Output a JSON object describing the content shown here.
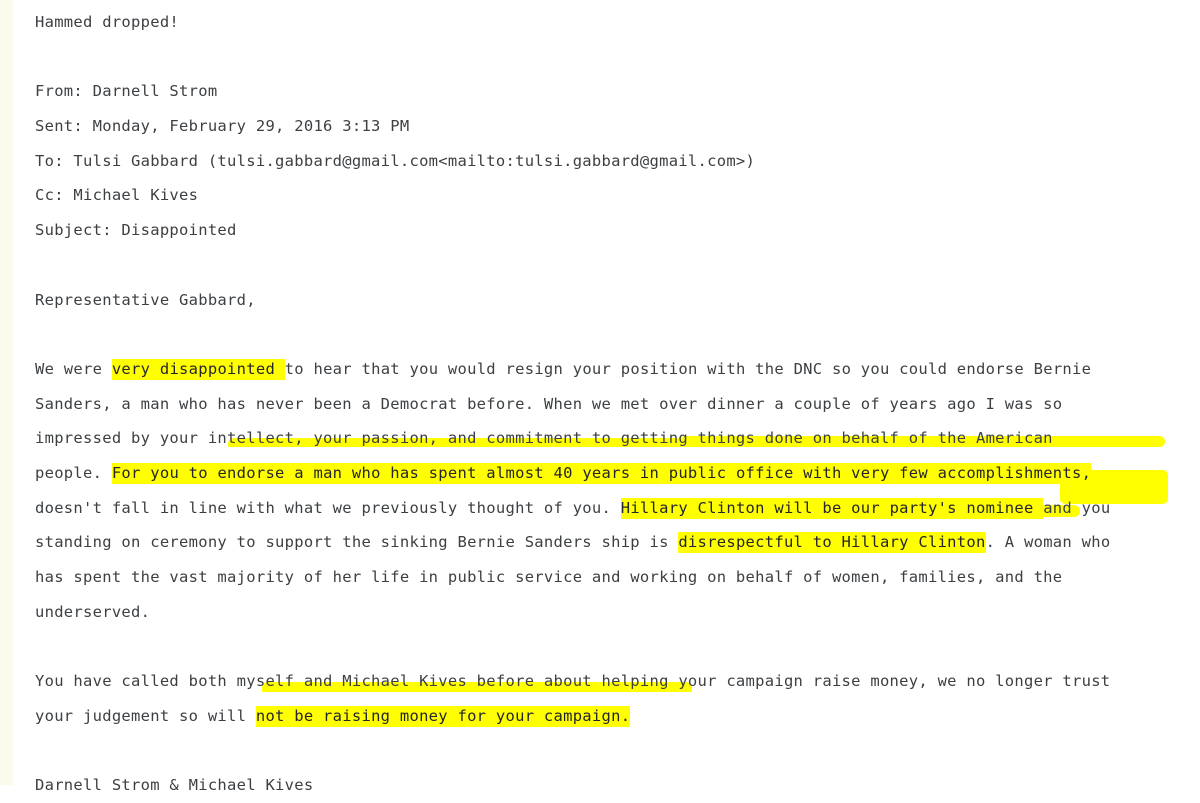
{
  "colors": {
    "page_background": "#ffffff",
    "left_strip": "#fbfaec",
    "body_text": "#3d4043",
    "highlight": "#ffff00",
    "highlighted_text": "#24262a"
  },
  "email": {
    "intro_note": "Hammed dropped!",
    "headers": [
      {
        "label": "From:",
        "value": "Darnell Strom",
        "full": "From: Darnell Strom"
      },
      {
        "label": "Sent:",
        "value": "Monday, February 29, 2016 3:13 PM",
        "full": "Sent: Monday, February 29, 2016 3:13 PM"
      },
      {
        "label": "To:",
        "value": "Tulsi Gabbard (tulsi.gabbard@gmail.com<mailto:tulsi.gabbard@gmail.com>)",
        "full": "To: Tulsi Gabbard (tulsi.gabbard@gmail.com<mailto:tulsi.gabbard@gmail.com>)"
      },
      {
        "label": "Cc:",
        "value": "Michael Kives",
        "full": "Cc: Michael Kives"
      },
      {
        "label": "Subject:",
        "value": "Disappointed",
        "full": "Subject: Disappointed"
      }
    ],
    "salutation": "Representative Gabbard,",
    "body_lines": [
      {
        "segments": [
          {
            "text": "We were ",
            "highlighted": false
          },
          {
            "text": "very disappointed ",
            "highlighted": true
          },
          {
            "text": "to hear that you would resign your position with the DNC so you could endorse Bernie",
            "highlighted": false
          }
        ]
      },
      {
        "segments": [
          {
            "text": "Sanders, a man who has never been a Democrat before. When we met over dinner a couple of years ago I was so",
            "highlighted": false
          }
        ]
      },
      {
        "segments": [
          {
            "text": "impressed by your intellect, your passion, and commitment to getting things done on behalf of the American",
            "highlighted": false
          }
        ]
      },
      {
        "segments": [
          {
            "text": "people. ",
            "highlighted": false
          },
          {
            "text": "For you to endorse a man who has spent almost 40 years in public office with very few accomplishments,",
            "highlighted": true
          }
        ]
      },
      {
        "segments": [
          {
            "text": "doesn't fall in line with what we previously thought of you. ",
            "highlighted": false
          },
          {
            "text": "Hillary Clinton will be our party's nominee ",
            "highlighted": true
          },
          {
            "text": "and you",
            "highlighted": false
          }
        ]
      },
      {
        "segments": [
          {
            "text": "standing on ceremony to support the sinking Bernie Sanders ship is ",
            "highlighted": false
          },
          {
            "text": "disrespectful to Hillary Clinton",
            "highlighted": true
          },
          {
            "text": ". A woman who",
            "highlighted": false
          }
        ]
      },
      {
        "segments": [
          {
            "text": "has spent the vast majority of her life in public service and working on behalf of women, families, and the",
            "highlighted": false
          }
        ]
      },
      {
        "segments": [
          {
            "text": "underserved.",
            "highlighted": false
          }
        ]
      },
      {
        "blank": true,
        "segments": []
      },
      {
        "segments": [
          {
            "text": "You have called both myself and Michael Kives before about helping your campaign raise money, we no longer trust",
            "highlighted": false
          }
        ]
      },
      {
        "segments": [
          {
            "text": "your judgement so will ",
            "highlighted": false
          },
          {
            "text": "not be raising money for your campaign.",
            "highlighted": true
          }
        ]
      },
      {
        "blank": true,
        "segments": []
      },
      {
        "segments": [
          {
            "text": "Darnell Strom & Michael Kives",
            "highlighted": false
          }
        ]
      }
    ],
    "signature": "Darnell Strom & Michael Kives"
  }
}
